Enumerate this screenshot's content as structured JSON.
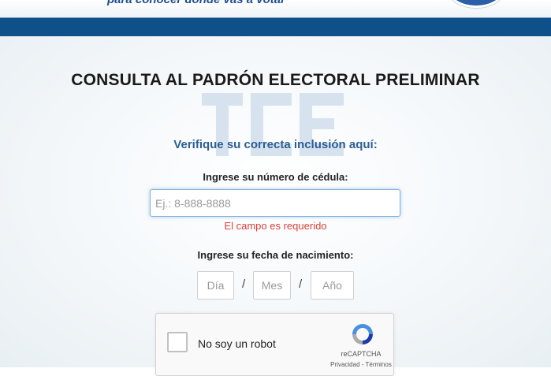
{
  "header": {
    "tagline": "para conocer dónde vas a votar"
  },
  "main": {
    "title": "CONSULTA AL PADRÓN ELECTORAL PRELIMINAR",
    "subtitle": "Verifique su correcta inclusión aquí:",
    "cedula_label": "Ingrese su número de cédula:",
    "cedula_placeholder": "Ej.: 8-888-8888",
    "cedula_error": "El campo es requerido",
    "birth_label": "Ingrese su fecha de nacimiento:",
    "day_placeholder": "Día",
    "month_placeholder": "Mes",
    "year_placeholder": "Año",
    "separator": "/"
  },
  "recaptcha": {
    "label": "No soy un robot",
    "brand": "reCAPTCHA",
    "links": "Privacidad - Términos"
  },
  "colors": {
    "header_band": "#0f4f8a",
    "accent_text": "#2c5e95",
    "error": "#d9413a",
    "watermark": "#d3e0ec"
  }
}
